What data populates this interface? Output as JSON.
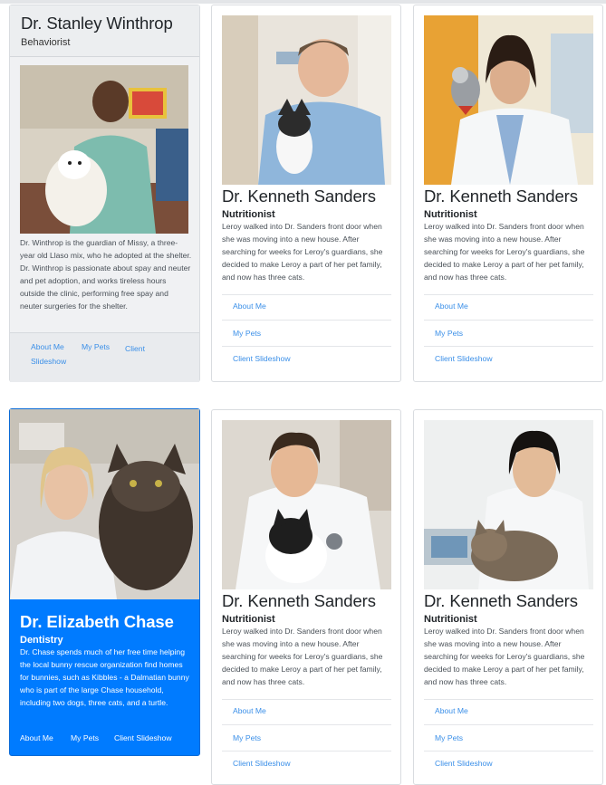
{
  "colors": {
    "accent": "#007bff",
    "link": "#3a8fe8",
    "grey_card": "#f0f1f3"
  },
  "cards": [
    {
      "name": "Dr. Stanley Winthrop",
      "role": "Behaviorist",
      "description": "Dr. Winthrop is the guardian of Missy, a three-year old Llaso mix, who he adopted at the shelter. Dr. Winthrop is passionate about spay and neuter and pet adoption, and works tireless hours outside the clinic, performing free spay and neuter surgeries for the shelter.",
      "links": [
        "About Me",
        "My Pets",
        "Client Slideshow"
      ],
      "photo": "vet-with-white-dog-photo"
    },
    {
      "name": "Dr. Kenneth Sanders",
      "role": "Nutritionist",
      "description": "Leroy walked into Dr. Sanders front door when she was moving into a new house. After searching for weeks for Leroy's guardians, she decided to make Leroy a part of her pet family, and now has three cats.",
      "links": [
        "About Me",
        "My Pets",
        "Client Slideshow"
      ],
      "photo": "vet-with-kitten-photo"
    },
    {
      "name": "Dr. Kenneth Sanders",
      "role": "Nutritionist",
      "description": "Leroy walked into Dr. Sanders front door when she was moving into a new house. After searching for weeks for Leroy's guardians, she decided to make Leroy a part of her pet family, and now has three cats.",
      "links": [
        "About Me",
        "My Pets",
        "Client Slideshow"
      ],
      "photo": "vet-with-parrot-photo"
    },
    {
      "name": "Dr. Elizabeth Chase",
      "role": "Dentistry",
      "description": "Dr. Chase spends much of her free time helping the local bunny rescue organization find homes for bunnies, such as Kibbles - a Dalmatian bunny who is part of the large Chase household, including two dogs, three cats, and a turtle.",
      "links": [
        "About Me",
        "My Pets",
        "Client Slideshow"
      ],
      "photo": "vet-with-maine-coon-photo"
    },
    {
      "name": "Dr. Kenneth Sanders",
      "role": "Nutritionist",
      "description": "Leroy walked into Dr. Sanders front door when she was moving into a new house. After searching for weeks for Leroy's guardians, she decided to make Leroy a part of her pet family, and now has three cats.",
      "links": [
        "About Me",
        "My Pets",
        "Client Slideshow"
      ],
      "photo": "vet-with-tuxedo-cat-photo"
    },
    {
      "name": "Dr. Kenneth Sanders",
      "role": "Nutritionist",
      "description": "Leroy walked into Dr. Sanders front door when she was moving into a new house. After searching for weeks for Leroy's guardians, she decided to make Leroy a part of her pet family, and now has three cats.",
      "links": [
        "About Me",
        "My Pets",
        "Client Slideshow"
      ],
      "photo": "vet-with-tabby-cat-photo"
    }
  ]
}
